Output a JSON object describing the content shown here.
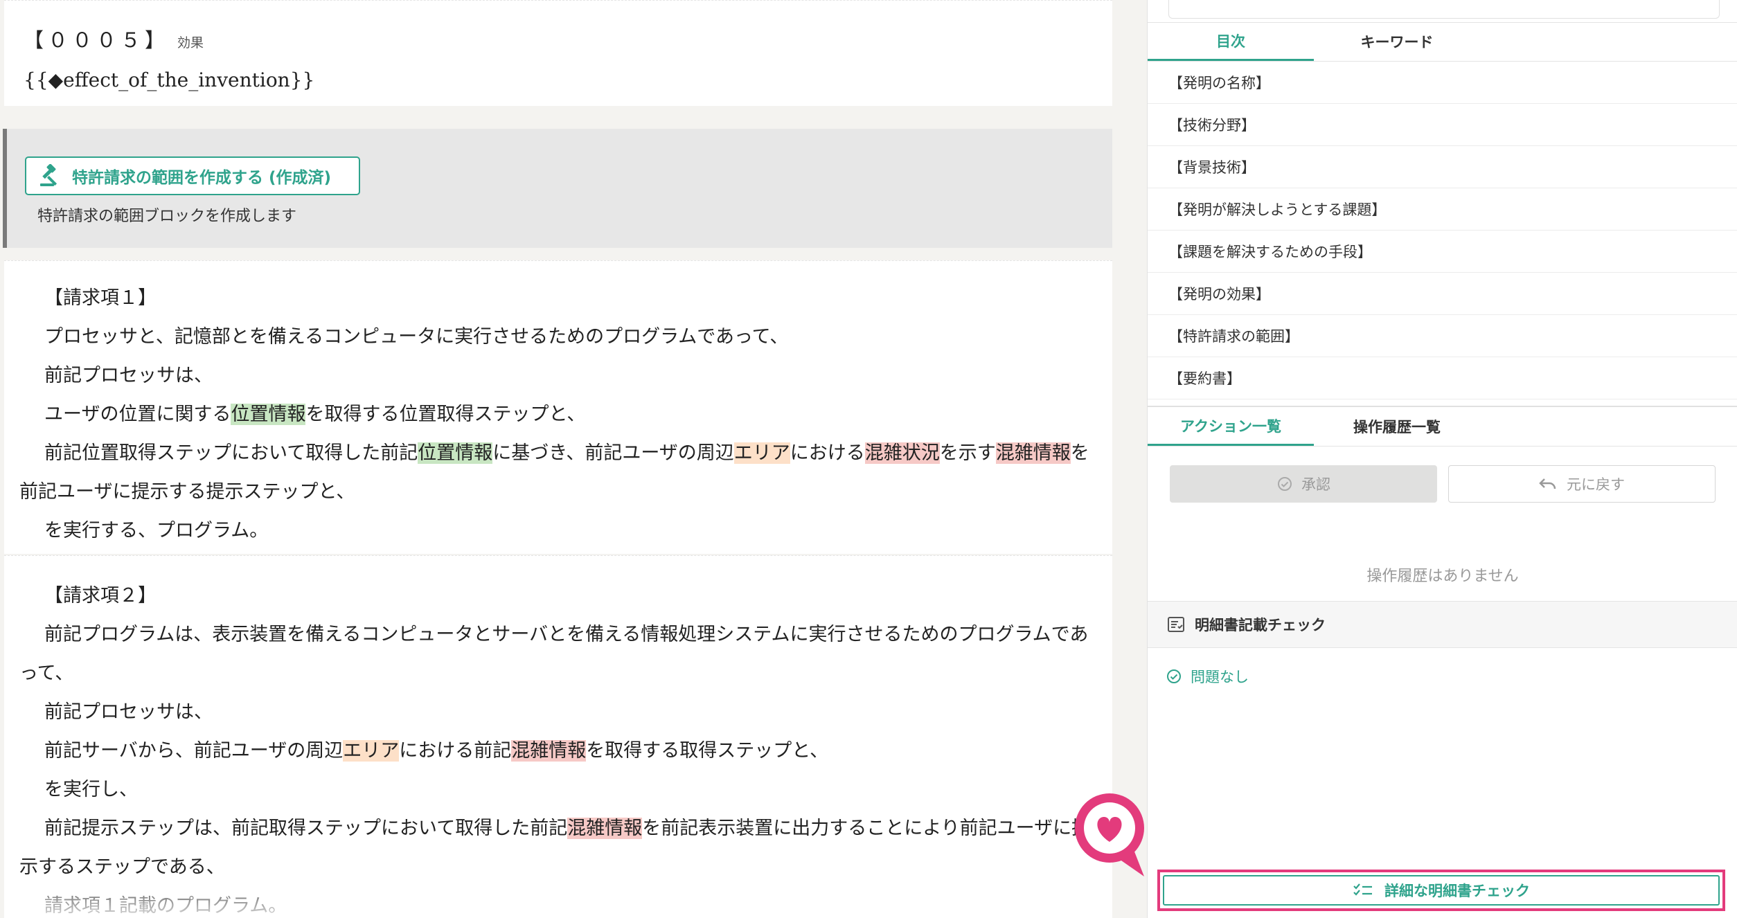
{
  "effect": {
    "title": "【０００５】",
    "subtitle": "効果",
    "placeholder": "{{◆effect_of_the_invention}}"
  },
  "claims_action": {
    "button_label": "特許請求の範囲を作成する (作成済)",
    "description": "特許請求の範囲ブロックを作成します"
  },
  "claims": {
    "claim1": {
      "heading": "【請求項１】",
      "l1": "プロセッサと、記憶部とを備えるコンピュータに実行させるためのプログラムであって、",
      "l2": "前記プロセッサは、",
      "l3a": "ユーザの位置に関する",
      "l3b": "位置情報",
      "l3c": "を取得する位置取得ステップと、",
      "l4a": "前記位置取得ステップにおいて取得した前記",
      "l4b": "位置情報",
      "l4c": "に基づき、前記ユーザの周辺",
      "l4d": "エリア",
      "l4e": "における",
      "l4f": "混雑状況",
      "l4g": "を示す",
      "l4h": "混雑情報",
      "l4i": "を前記ユーザに提示する提示ステップと、",
      "l5": "を実行する、プログラム。"
    },
    "claim2": {
      "heading": "【請求項２】",
      "l1": "前記プログラムは、表示装置を備えるコンピュータとサーバとを備える情報処理システムに実行させるためのプログラムであって、",
      "l2": "前記プロセッサは、",
      "l3a": "前記サーバから、前記ユーザの周辺",
      "l3b": "エリア",
      "l3c": "における前記",
      "l3d": "混雑情報",
      "l3e": "を取得する取得ステップと、",
      "l4": "を実行し、",
      "l5a": "前記提示ステップは、前記取得ステップにおいて取得した前記",
      "l5b": "混雑情報",
      "l5c": "を前記表示装置に出力することにより前記ユーザに提示するステップである、",
      "l6": "請求項１記載のプログラム。"
    }
  },
  "right_panel": {
    "tabs": [
      "目次",
      "キーワード"
    ],
    "active_tab": "目次",
    "toc": [
      "【発明の名称】",
      "【技術分野】",
      "【背景技術】",
      "【発明が解決しようとする課題】",
      "【課題を解決するための手段】",
      "【発明の効果】",
      "【特許請求の範囲】",
      "【要約書】"
    ],
    "action_tabs": [
      "アクション一覧",
      "操作履歴一覧"
    ],
    "active_action_tab": "アクション一覧",
    "approve_label": "承認",
    "undo_label": "元に戻す",
    "empty_history": "操作履歴はありません",
    "check_title": "明細書記載チェック",
    "check_result": "問題なし",
    "detail_button": "詳細な明細書チェック"
  },
  "colors": {
    "accent": "#2fa38c",
    "highlight_green": "#c8e6c2",
    "highlight_orange": "#fde0c8",
    "highlight_red": "#f6c9c6",
    "callout_pink": "#e33b7c"
  },
  "icons": [
    "gavel-icon",
    "check-circle-icon",
    "undo-icon",
    "checklist-icon",
    "heart-icon"
  ]
}
